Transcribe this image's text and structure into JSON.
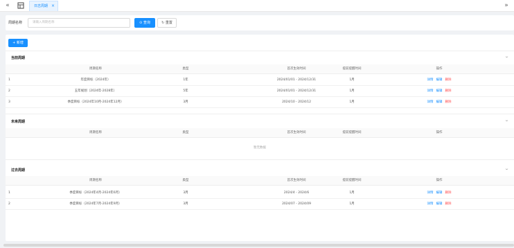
{
  "tabbar": {
    "prev_icon": "double-chevron-left-icon",
    "next_icon": "double-chevron-right-icon",
    "home_icon": "grid-icon",
    "active_tab": "日志周期"
  },
  "search": {
    "label": "周期名称",
    "placeholder": "请输入周期名称",
    "query_label": "查询",
    "reset_label": "重置"
  },
  "toolbar": {
    "add_label": "+ 新增"
  },
  "columns": {
    "name": "周期名称",
    "type": "类型",
    "time": "首次生效时间",
    "remind": "提前提醒时间",
    "op": "操作"
  },
  "ops": {
    "detail": "详情",
    "edit": "编辑",
    "delete": "删除"
  },
  "current": {
    "title": "当前周期",
    "rows": [
      {
        "idx": "1",
        "name": "年度目标（2024年）",
        "type": "1年",
        "time": "2024/01/01 - 2024/12/31",
        "remind": "1月"
      },
      {
        "idx": "2",
        "name": "五年规划（2024年-2028年）",
        "type": "5年",
        "time": "2024/01/01 - 2024/12/31",
        "remind": "1月"
      },
      {
        "idx": "3",
        "name": "季度目标（2024年10月-2024年12月）",
        "type": "3月",
        "time": "2024/10 - 2024/12",
        "remind": "1月"
      }
    ]
  },
  "future": {
    "title": "未来周期",
    "empty": "暂无数据"
  },
  "past": {
    "title": "过去周期",
    "rows": [
      {
        "idx": "1",
        "name": "季度目标（2024年4月-2024年6月）",
        "type": "3月",
        "time": "2024/4 - 2024/6",
        "remind": "1月"
      },
      {
        "idx": "2",
        "name": "季度目标（2024年7月-2024年9月）",
        "type": "3月",
        "time": "2024/07 - 2024/09",
        "remind": "1月"
      }
    ]
  },
  "colors": {
    "primary": "#1890ff",
    "danger": "#ff4d4f"
  }
}
